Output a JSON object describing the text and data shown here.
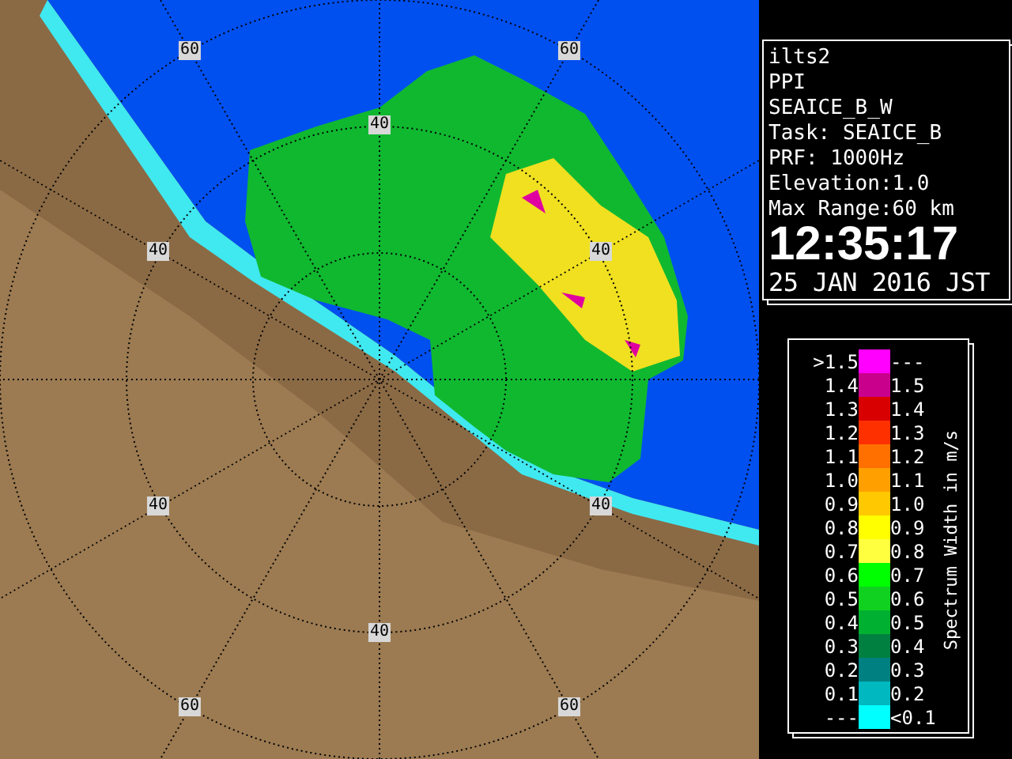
{
  "map": {
    "range_labels": [
      "60",
      "60",
      "40",
      "40",
      "40",
      "40",
      "40",
      "40",
      "60",
      "60"
    ]
  },
  "info": {
    "lines": [
      "ilts2",
      "PPI",
      "SEAICE_B_W",
      "Task: SEAICE_B",
      "PRF: 1000Hz",
      "Elevation:1.0",
      "Max Range:60 km"
    ],
    "time": "12:35:17",
    "date": "25 JAN 2016 JST"
  },
  "legend": {
    "title": "Spectrum Width in m/s",
    "rows": [
      {
        "low": ">1.5",
        "high": "---",
        "color": "#ff00ff"
      },
      {
        "low": "1.4",
        "high": "1.5",
        "color": "#c8008c"
      },
      {
        "low": "1.3",
        "high": "1.4",
        "color": "#d80000"
      },
      {
        "low": "1.2",
        "high": "1.3",
        "color": "#ff3000"
      },
      {
        "low": "1.1",
        "high": "1.2",
        "color": "#ff7000"
      },
      {
        "low": "1.0",
        "high": "1.1",
        "color": "#ffa000"
      },
      {
        "low": "0.9",
        "high": "1.0",
        "color": "#ffc800"
      },
      {
        "low": "0.8",
        "high": "0.9",
        "color": "#ffff00"
      },
      {
        "low": "0.7",
        "high": "0.8",
        "color": "#ffff40"
      },
      {
        "low": "0.6",
        "high": "0.7",
        "color": "#00ff00"
      },
      {
        "low": "0.5",
        "high": "0.6",
        "color": "#10d020"
      },
      {
        "low": "0.4",
        "high": "0.5",
        "color": "#00b030"
      },
      {
        "low": "0.3",
        "high": "0.4",
        "color": "#008040"
      },
      {
        "low": "0.2",
        "high": "0.3",
        "color": "#008080"
      },
      {
        "low": "0.1",
        "high": "0.2",
        "color": "#00b8c0"
      },
      {
        "low": "---",
        "high": "<0.1",
        "color": "#00ffff"
      }
    ]
  }
}
